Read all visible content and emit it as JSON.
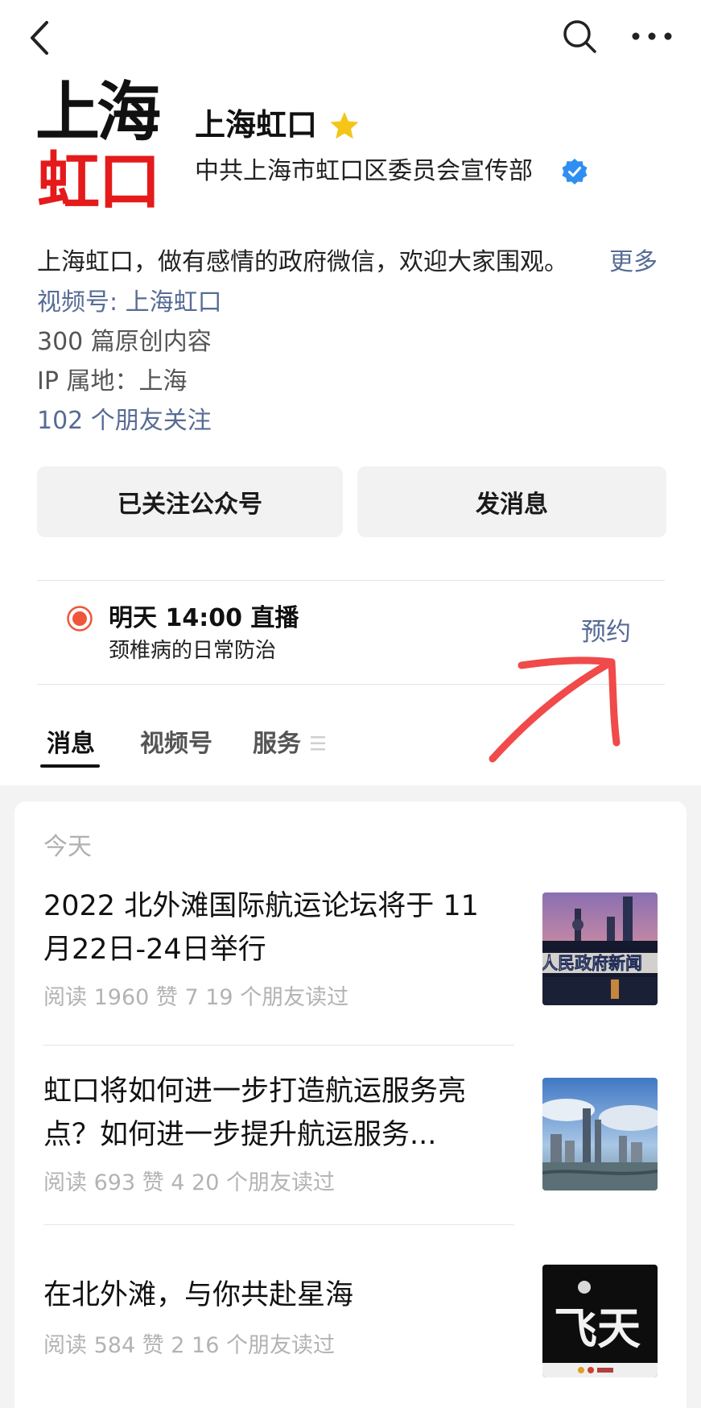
{
  "account": {
    "logo_line1": "上海",
    "logo_line2": "虹口",
    "name": "上海虹口",
    "organization": "中共上海市虹口区委员会宣传部",
    "bio": "上海虹口，做有感情的政府微信，欢迎大家围观。",
    "more_label": "更多",
    "channel": "视频号: 上海虹口",
    "original_count": "300 篇原创内容",
    "ip_location": "IP 属地：上海",
    "friends_following": "102 个朋友关注"
  },
  "actions": {
    "followed_label": "已关注公众号",
    "message_label": "发消息"
  },
  "live": {
    "title": "明天 14:00 直播",
    "subtitle": "颈椎病的日常防治",
    "reserve_label": "预约"
  },
  "tabs": [
    {
      "label": "消息",
      "active": true
    },
    {
      "label": "视频号",
      "active": false
    },
    {
      "label": "服务",
      "active": false
    }
  ],
  "feed": {
    "date_label": "今天",
    "articles": [
      {
        "title": "2022 北外滩国际航运论坛将于 11 月22日-24日举行",
        "meta": "阅读 1960   赞 7   19 个朋友读过",
        "thumb_text": "人民政府新闻"
      },
      {
        "title": "虹口将如何进一步打造航运服务亮点？如何进一步提升航运服务...",
        "meta": "阅读 693   赞 4   20 个朋友读过"
      },
      {
        "title": "在北外滩，与你共赴星海",
        "meta": "阅读 584   赞 2   16 个朋友读过",
        "thumb_text": "飞天"
      }
    ]
  },
  "icons": {
    "back": "chevron-left-icon",
    "search": "search-icon",
    "more": "more-dots-icon",
    "star": "star-icon",
    "verified": "verified-badge-icon",
    "live": "live-dot-icon",
    "menu": "menu-icon"
  },
  "colors": {
    "link": "#576b95",
    "star": "#f5c518",
    "verified": "#2e8ff0",
    "live": "#f0553a",
    "logo_red": "#e51a1a",
    "annotation": "#f04a4a"
  }
}
